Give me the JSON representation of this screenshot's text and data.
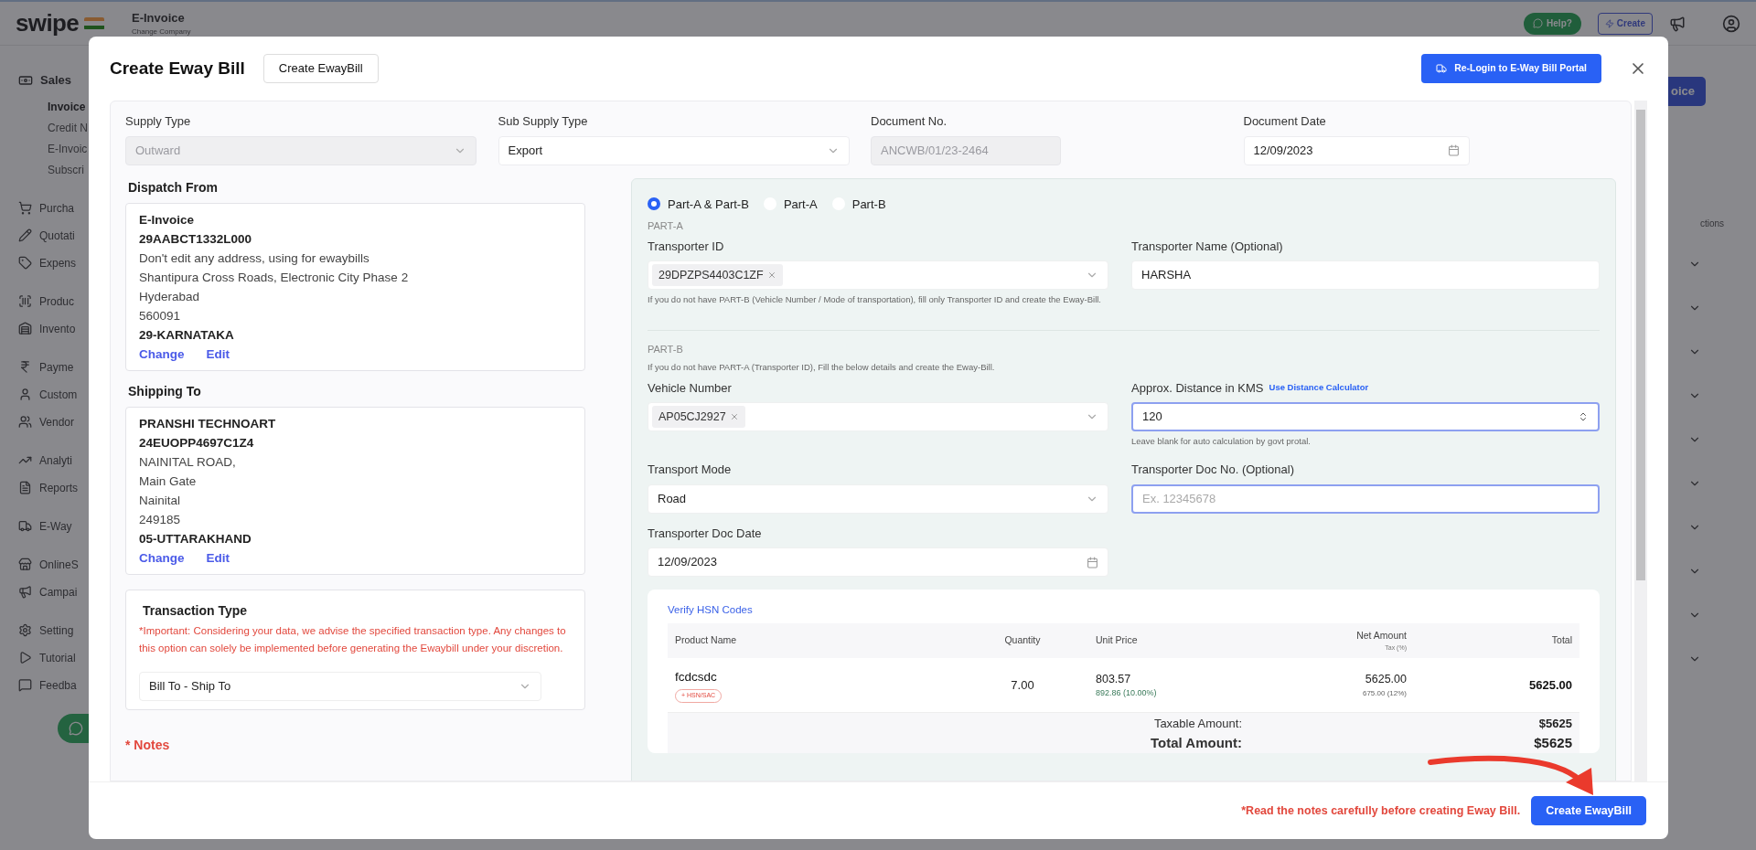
{
  "app": {
    "logo": "swipe",
    "company": "E-Invoice",
    "company_action": "Change Company",
    "help": "Help?",
    "create": "Create",
    "page_button": "oice",
    "table_header": "ctions"
  },
  "sidebar": {
    "section": "Sales",
    "sub_items": [
      {
        "label": "Invoice",
        "selected": true
      },
      {
        "label": "Credit N",
        "selected": false
      },
      {
        "label": "E-Invoic",
        "selected": false
      },
      {
        "label": "Subscri",
        "selected": false
      }
    ],
    "groups": [
      [
        "Purcha",
        "Quotati",
        "Expens"
      ],
      [
        "Produc",
        "Invento"
      ],
      [
        "Payme",
        "Custom",
        "Vendor"
      ],
      [
        "Analyti",
        "Reports"
      ],
      [
        "E-Way"
      ],
      [
        "OnlineS",
        "Campai"
      ],
      [
        "Setting",
        "Tutorial",
        "Feedba"
      ]
    ]
  },
  "modal": {
    "title": "Create Eway Bill",
    "tab_button": "Create EwayBill",
    "relogin": "Re-Login to E-Way Bill Portal",
    "fields": [
      {
        "label": "Supply Type",
        "value": "Outward",
        "kind": "select",
        "disabled": true
      },
      {
        "label": "Sub Supply Type",
        "value": "Export",
        "kind": "select",
        "disabled": false
      },
      {
        "label": "Document No.",
        "value": "ANCWB/01/23-2464",
        "kind": "text",
        "disabled": true
      },
      {
        "label": "Document Date",
        "value": "12/09/2023",
        "kind": "date",
        "disabled": false
      }
    ],
    "addresses": [
      {
        "heading": "Dispatch From",
        "lines": [
          {
            "text": "E-Invoice",
            "bold": true
          },
          {
            "text": "29AABCT1332L000",
            "bold": true
          },
          {
            "text": "Don't edit any address, using for ewaybills",
            "bold": false
          },
          {
            "text": "Shantipura Cross Roads, Electronic City Phase 2",
            "bold": false
          },
          {
            "text": "Hyderabad",
            "bold": false
          },
          {
            "text": "560091",
            "bold": false
          },
          {
            "text": "29-KARNATAKA",
            "bold": true
          }
        ],
        "actions": [
          "Change",
          "Edit"
        ]
      },
      {
        "heading": "Shipping To",
        "lines": [
          {
            "text": "PRANSHI TECHNOART",
            "bold": true
          },
          {
            "text": "24EUOPP4697C1Z4",
            "bold": true
          },
          {
            "text": "NAINITAL ROAD,",
            "bold": false
          },
          {
            "text": "Main Gate",
            "bold": false
          },
          {
            "text": "Nainital",
            "bold": false
          },
          {
            "text": "249185",
            "bold": false
          },
          {
            "text": "05-UTTARAKHAND",
            "bold": true
          }
        ],
        "actions": [
          "Change",
          "Edit"
        ]
      }
    ],
    "transaction": {
      "heading": "Transaction Type",
      "warning": "*Important: Considering your data, we advise the specified transaction type. Any changes to this option can solely be implemented before generating the Ewaybill under your discretion.",
      "value": "Bill To - Ship To"
    },
    "notes_heading": "* Notes",
    "parts": {
      "options": [
        {
          "label": "Part-A & Part-B",
          "selected": true
        },
        {
          "label": "Part-A",
          "selected": false
        },
        {
          "label": "Part-B",
          "selected": false
        }
      ],
      "part_a": {
        "label": "PART-A",
        "transporter_id": {
          "label": "Transporter ID",
          "tag": "29DPZPS4403C1ZF",
          "hint": "If you do not have PART-B (Vehicle Number / Mode of transportation), fill only Transporter ID and create the Eway-Bill."
        },
        "transporter_name": {
          "label": "Transporter Name (Optional)",
          "value": "HARSHA"
        }
      },
      "part_b": {
        "label": "PART-B",
        "hint": "If you do not have PART-A (Transporter ID), Fill the below details and create the Eway-Bill.",
        "vehicle": {
          "label": "Vehicle Number",
          "tag": "AP05CJ2927"
        },
        "distance": {
          "label": "Approx. Distance in KMS",
          "link": "Use Distance Calculator",
          "value": "120",
          "hint": "Leave blank for auto calculation by govt protal.",
          "focused": true
        },
        "mode": {
          "label": "Transport Mode",
          "value": "Road"
        },
        "doc_no": {
          "label": "Transporter Doc No. (Optional)",
          "placeholder": "Ex. 12345678",
          "focused": true
        },
        "doc_date": {
          "label": "Transporter Doc Date",
          "value": "12/09/2023"
        }
      }
    },
    "items": {
      "link": "Verify HSN Codes",
      "columns": [
        {
          "label": "Product Name"
        },
        {
          "label": "Quantity"
        },
        {
          "label": "Unit Price"
        },
        {
          "label": "Net Amount",
          "sub": "Tax (%)"
        },
        {
          "label": "Total"
        }
      ],
      "rows": [
        {
          "name": "fcdcsdc",
          "badge": "+ HSN/SAC",
          "quantity": "7.00",
          "unit_price": "803.57",
          "unit_sub": "892.86 (10.00%)",
          "net": "5625.00",
          "net_sub": "675.00 (12%)",
          "total": "5625.00"
        }
      ],
      "summary": [
        {
          "label": "Taxable Amount:",
          "value": "$5625",
          "bold": false
        },
        {
          "label": "Total Amount:",
          "value": "$5625",
          "bold": true
        }
      ]
    },
    "footer": {
      "note": "*Read the notes carefully before creating Eway Bill.",
      "button": "Create EwayBill"
    }
  }
}
